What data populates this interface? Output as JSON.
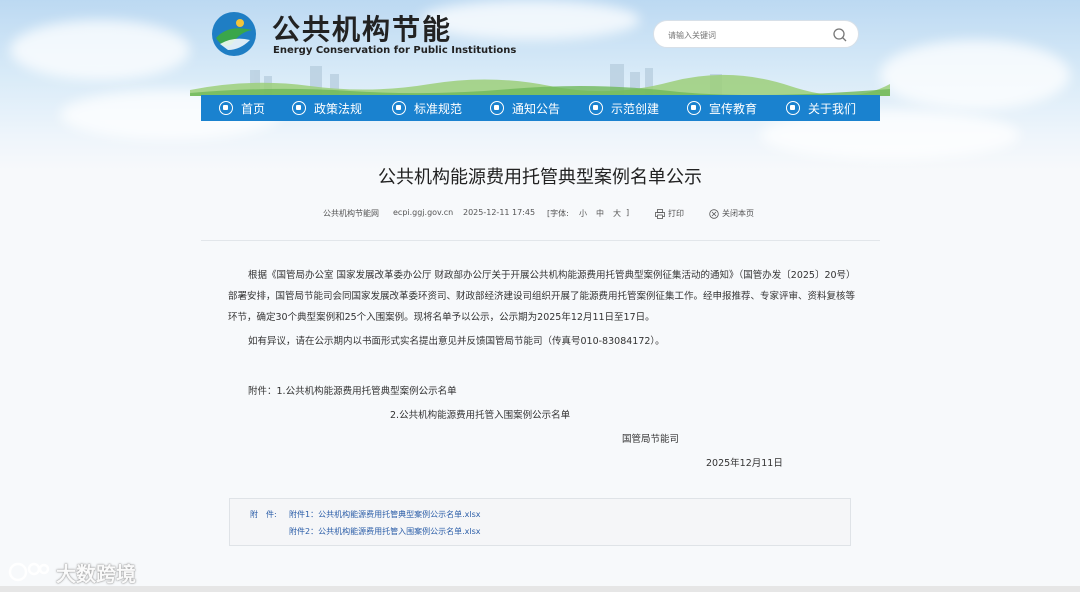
{
  "header": {
    "site_title": "公共机构节能",
    "site_subtitle": "Energy Conservation for Public Institutions",
    "search_placeholder": "请输入关键词"
  },
  "nav": {
    "items": [
      {
        "label": "首页",
        "icon": "home-icon"
      },
      {
        "label": "政策法规",
        "icon": "policy-icon"
      },
      {
        "label": "标准规范",
        "icon": "standard-icon"
      },
      {
        "label": "通知公告",
        "icon": "notice-icon"
      },
      {
        "label": "示范创建",
        "icon": "demo-icon"
      },
      {
        "label": "宣传教育",
        "icon": "education-icon"
      },
      {
        "label": "关于我们",
        "icon": "about-icon"
      }
    ]
  },
  "article": {
    "title": "公共机构能源费用托管典型案例名单公示",
    "meta": {
      "source": "公共机构节能网",
      "domain": "ecpi.ggj.gov.cn",
      "date": "2025-12-11 17:45",
      "font_size_label": "[字体:",
      "font_small": "小",
      "font_medium": "中",
      "font_large": "大",
      "font_close": "]",
      "print": "打印",
      "close": "关闭本页"
    },
    "paragraph1": "根据《国管局办公室 国家发展改革委办公厅 财政部办公厅关于开展公共机构能源费用托管典型案例征集活动的通知》（国管办发〔2025〕20号）部署安排，国管局节能司会同国家发展改革委环资司、财政部经济建设司组织开展了能源费用托管案例征集工作。经申报推荐、专家评审、资料复核等环节，确定30个典型案例和25个入围案例。现将名单予以公示，公示期为2025年12月11日至17日。",
    "paragraph2": "如有异议，请在公示期内以书面形式实名提出意见并反馈国管局节能司（传真号010-83084172）。",
    "attachment_line1": "附件：1.公共机构能源费用托管典型案例公示名单",
    "attachment_line2": "2.公共机构能源费用托管入围案例公示名单",
    "signature": "国管局节能司",
    "sign_date": "2025年12月11日"
  },
  "attachments": {
    "label": "附　件:",
    "files": [
      "附件1：公共机构能源费用托管典型案例公示名单.xlsx",
      "附件2：公共机构能源费用托管入围案例公示名单.xlsx"
    ]
  },
  "watermark": {
    "text": "大数跨境"
  },
  "colors": {
    "nav_bg": "#1a82cf",
    "link": "#2c5ea8"
  }
}
